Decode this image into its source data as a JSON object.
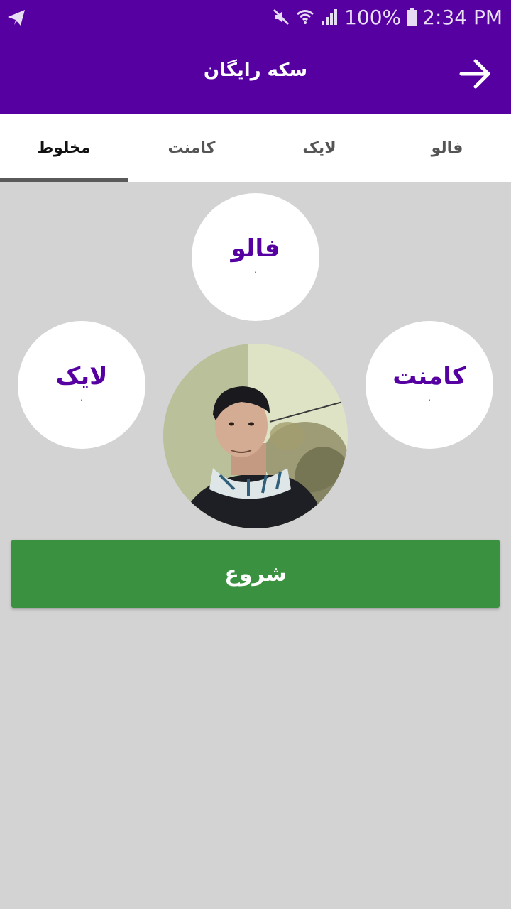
{
  "status_bar": {
    "left_icon": "telegram-send-icon",
    "icons": [
      "mute-icon",
      "wifi-icon",
      "signal-icon"
    ],
    "battery": "100%",
    "time": "2:34 PM"
  },
  "toolbar": {
    "title": "سکه رایگان",
    "back_icon": "arrow-right-icon"
  },
  "tabs": [
    {
      "label": "فالو",
      "active": false
    },
    {
      "label": "لایک",
      "active": false
    },
    {
      "label": "کامنت",
      "active": false
    },
    {
      "label": "مخلوط",
      "active": true
    }
  ],
  "counters": {
    "follow": {
      "label": "فالو",
      "count": "۰"
    },
    "like": {
      "label": "لایک",
      "count": "۰"
    },
    "comment": {
      "label": "کامنت",
      "count": "۰"
    }
  },
  "start_button": {
    "label": "شروع"
  },
  "colors": {
    "primary": "#5600a2",
    "accent_green": "#3a913f",
    "background": "#d3d3d3"
  }
}
